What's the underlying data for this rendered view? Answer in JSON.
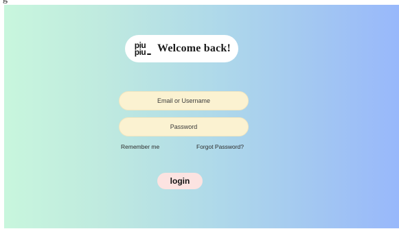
{
  "caption": "g",
  "brand": {
    "logo_line1": "piu",
    "logo_line2": "piu",
    "welcome_text": "Welcome back!"
  },
  "form": {
    "email_placeholder": "Email or Username",
    "password_placeholder": "Password",
    "remember_label": "Remember me",
    "forgot_label": "Forgot Password?",
    "login_label": "login"
  },
  "colors": {
    "gradient_left": "#c8f6dd",
    "gradient_right": "#98b8fb",
    "input_fill": "#fbf2d1",
    "button_fill": "#fce3e1"
  }
}
